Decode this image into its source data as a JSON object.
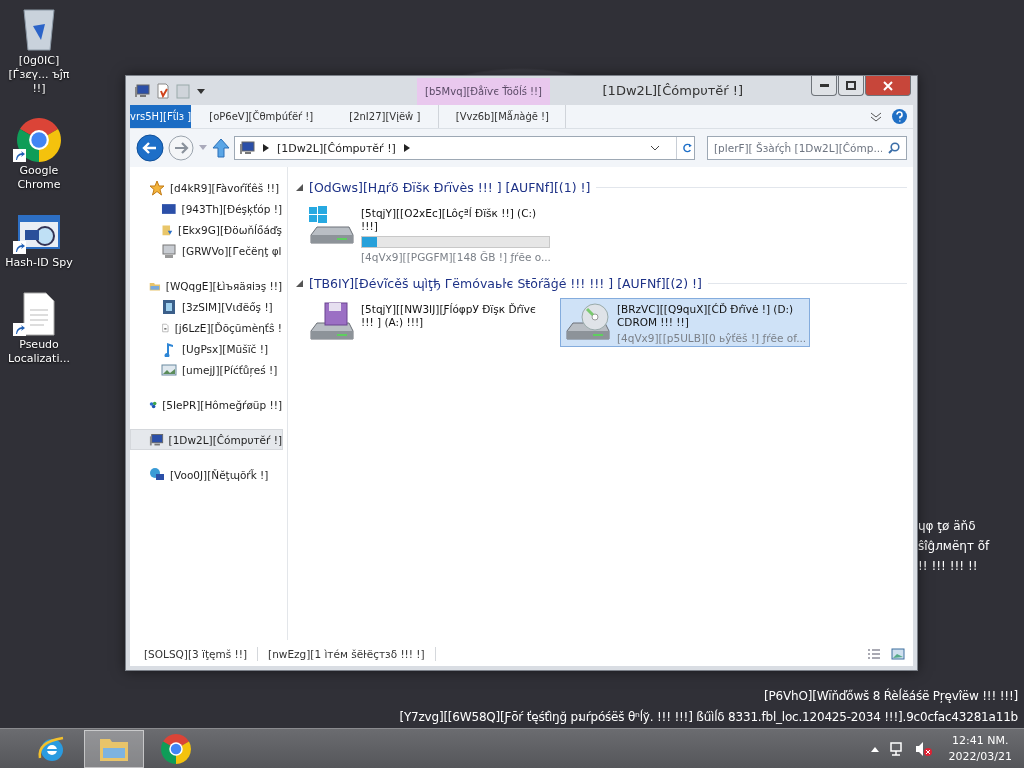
{
  "desktop_icons": [
    {
      "kind": "recycle-bin",
      "label": "[0g0IC][Ѓзȼγ... ъĵπ !!]"
    },
    {
      "kind": "chrome",
      "label": "Google Chrome"
    },
    {
      "kind": "hash-spy",
      "label": "Hash-ID Spy"
    },
    {
      "kind": "document",
      "label": "Pseudo Localizati..."
    }
  ],
  "window": {
    "title": "[1Dw2L][Ĉómpυтĕŕ !]",
    "context_tab": "[b5Mvq][Ðåïѵє Ťöőĺś !!]",
    "ribbon_tabs": [
      {
        "kind": "file",
        "label": "vrs5H][Fΐlɜ ]",
        "selected": false
      },
      {
        "kind": "tab",
        "label": "[oP6eV][Čθmþúťëŕ !]",
        "selected": false
      },
      {
        "kind": "tab",
        "label": "[2nI27][Vįëŵ ]",
        "selected": false
      },
      {
        "kind": "context",
        "label": "[Vvz6b][Mǻлàġē !]",
        "selected": false
      }
    ],
    "address": {
      "path": "[1Dw2L][Ĉómpυтĕŕ !]",
      "search_placeholder": "[plerF][ Šзàŕçĥ [1Dw2L][Ĉómp..."
    },
    "nav_pane": [
      {
        "kind": "favorites",
        "label": "[d4kR9][Fàvoŕĭťêš !!]",
        "selected": false,
        "children": [
          {
            "kind": "desktop",
            "label": "[943Th][Ðéşķťóp !]",
            "selected": false
          },
          {
            "kind": "downloads",
            "label": "[Ekx9G][Ðöωňĺőáďş",
            "selected": false
          },
          {
            "kind": "recent",
            "label": "[GRWVo][Гečëηţ φl",
            "selected": false
          }
        ]
      },
      {
        "kind": "libraries",
        "label": "[WQqgE][Łìъяäяіэş !!]",
        "selected": false,
        "children": [
          {
            "kind": "videos",
            "label": "[3zSIM][Vɩđëőş !]",
            "selected": false
          },
          {
            "kind": "documents",
            "label": "[j6LzE][Ďõçũmèηťŝ !",
            "selected": false
          },
          {
            "kind": "music",
            "label": "[UgPsx][Mūšïč !]",
            "selected": false
          },
          {
            "kind": "pictures",
            "label": "[umejJ][Píćťůŗeś !]",
            "selected": false
          }
        ]
      },
      {
        "kind": "homegroup",
        "label": "[5IePR][Hômeğŕøüp !!]",
        "selected": false
      },
      {
        "kind": "computer",
        "label": "[1Dw2L][Ĉómpυтĕŕ !]",
        "selected": true
      },
      {
        "kind": "network",
        "label": "[Voo0J][Ňĕţɰõŕǩ !]",
        "selected": false
      }
    ],
    "groups": [
      {
        "title": "[OdGws][Hдŕδ Ðïšк Ðŕïvès !!! ] [AUFNf][(1) !]",
        "expanded": true,
        "items": [
          {
            "kind": "hard-disk",
            "name": "[5tqjY][[O2xEc][Lôçªĺ Ðïšк !!] (C:) !!!]",
            "level": 0.08,
            "free": "[4qVx9][[PGGFM][148 ĞB !] ƒŕēe o...",
            "selected": false
          }
        ]
      },
      {
        "title": "[TB6IY][Ðévĩcěš ɰìţђ Гëmóvaьŀє Sŧōŕãġé !!! !!! ] [AUFNf][(2) !]",
        "expanded": true,
        "items": [
          {
            "kind": "floppy",
            "name": "[5tqjY][[NW3IJ][ƑĺóφpУ Ðïşк Ďŕïvє !!! ] (A:) !!!]",
            "selected": false
          },
          {
            "kind": "cd",
            "name": "[BRzVC][[Q9quX][ĆĎ Ðŕïvė !] (D:) CDROM !!! !!]",
            "free": "[4qVx9][[p5ULB][0 ьŷťëš !] ƒŕēe of...",
            "selected": true
          }
        ]
      }
    ],
    "status_bar": {
      "count": "[SOLSQ][3 ïţęmš !!]",
      "selection": "[nwEzg][1 ìтéм šëŀëçтзδ !!! !]"
    }
  },
  "desktop_fragments": [
    "ɥφ ţø äňδ",
    "ŝîĝлмëηт õf",
    "!! !!! !!! !!"
  ],
  "watermark": [
    "[P6VhO][Wïňďőwš 8 Ŕèĺĕáśë Pŗęvîëw !!! !!!]",
    "[Y7zvg][[6W58Q][Ƒōŕ ťęśťìŋğ pมŕpóśëš θⁿĺў. !!! !!!] ßűìĺδ 8331.fbl_loc.120425-2034 !!!].9c0cfac43281a11b"
  ],
  "taskbar": {
    "apps": [
      {
        "kind": "ie",
        "selected": false
      },
      {
        "kind": "explorer",
        "selected": true
      },
      {
        "kind": "chrome",
        "selected": false
      }
    ],
    "time": "12:41 NM.",
    "date": "2022/03/21"
  }
}
